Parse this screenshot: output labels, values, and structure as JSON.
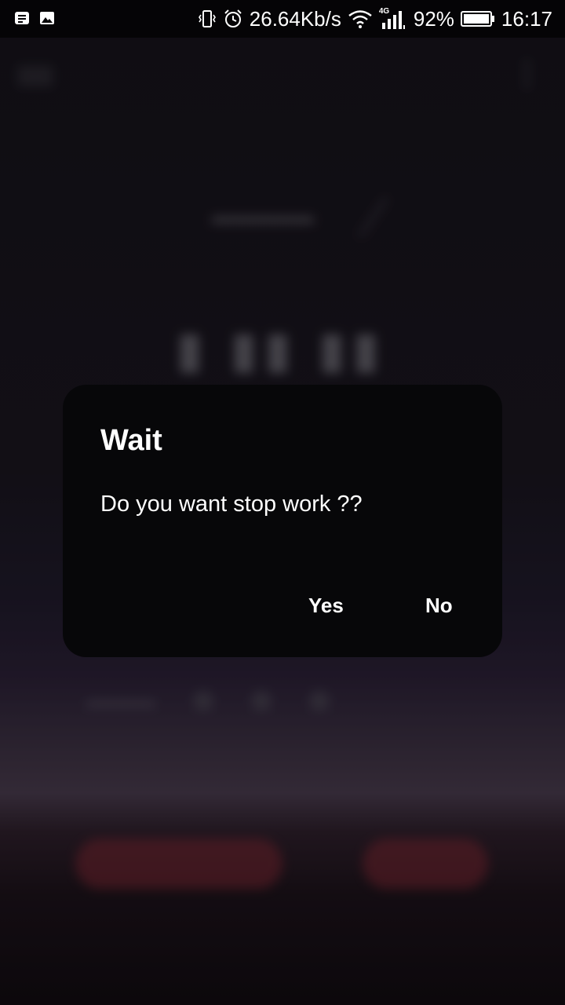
{
  "status_bar": {
    "network_speed": "26.64Kb/s",
    "network_type": "4G",
    "battery": "92%",
    "time": "16:17",
    "icons": [
      "notes-icon",
      "image-icon",
      "vibrate-icon",
      "alarm-icon",
      "wifi-icon",
      "signal-icon",
      "battery-icon"
    ]
  },
  "dialog": {
    "title": "Wait",
    "message": "Do you want stop work ??",
    "yes_label": "Yes",
    "no_label": "No"
  },
  "colors": {
    "dialog_background": "#070709",
    "accent_button": "#8c2a35"
  }
}
